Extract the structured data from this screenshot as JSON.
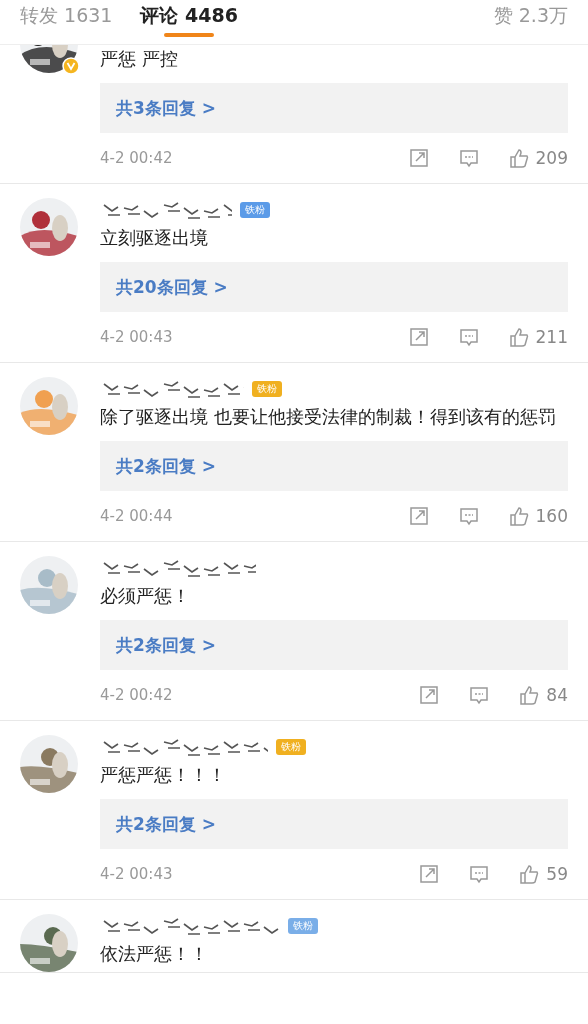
{
  "tabs": [
    {
      "label": "转发 1631",
      "selected": false
    },
    {
      "label": "评论 4486",
      "selected": true
    }
  ],
  "likes_total": "赞 2.3万",
  "top_comment": {
    "verified": true,
    "text": "严惩 严控",
    "replies": "共3条回复 >",
    "time": "4-2 00:42",
    "likes": "209"
  },
  "comments": [
    {
      "badge": {
        "label": "铁粉",
        "color": "#5b9be8"
      },
      "text": "立刻驱逐出境",
      "replies": "共20条回复 >",
      "time": "4-2 00:43",
      "likes": "211"
    },
    {
      "badge": {
        "label": "铁粉",
        "color": "#f0b020"
      },
      "text": "除了驱逐出境 也要让他接受法律的制裁！得到该有的惩罚",
      "replies": "共2条回复 >",
      "time": "4-2 00:44",
      "likes": "160"
    },
    {
      "text": "必须严惩！",
      "replies": "共2条回复 >",
      "time": "4-2 00:42",
      "likes": "84"
    },
    {
      "badge": {
        "label": "铁粉",
        "color": "#f0b020"
      },
      "text": "严惩严惩！！！",
      "replies": "共2条回复 >",
      "time": "4-2 00:43",
      "likes": "59"
    },
    {
      "badge": {
        "label": "铁粉",
        "color": "#7aaee8"
      },
      "text": "依法严惩！！"
    }
  ]
}
